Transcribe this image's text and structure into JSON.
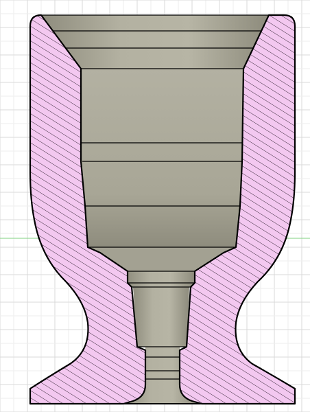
{
  "viewport": {
    "background": "#ffffff",
    "grid_major_color": "#d9d9d9",
    "grid_minor_color": "#eeeeee",
    "green_axis_color": "#7fd27f",
    "grid_visible": true
  },
  "section_view": {
    "hatch_fill": "#f3c8f0",
    "hatch_line": "#3a2a3a",
    "outline": "#000000",
    "bore_color_light": "#b9b7a6",
    "bore_color_dark": "#8e8c7c"
  }
}
